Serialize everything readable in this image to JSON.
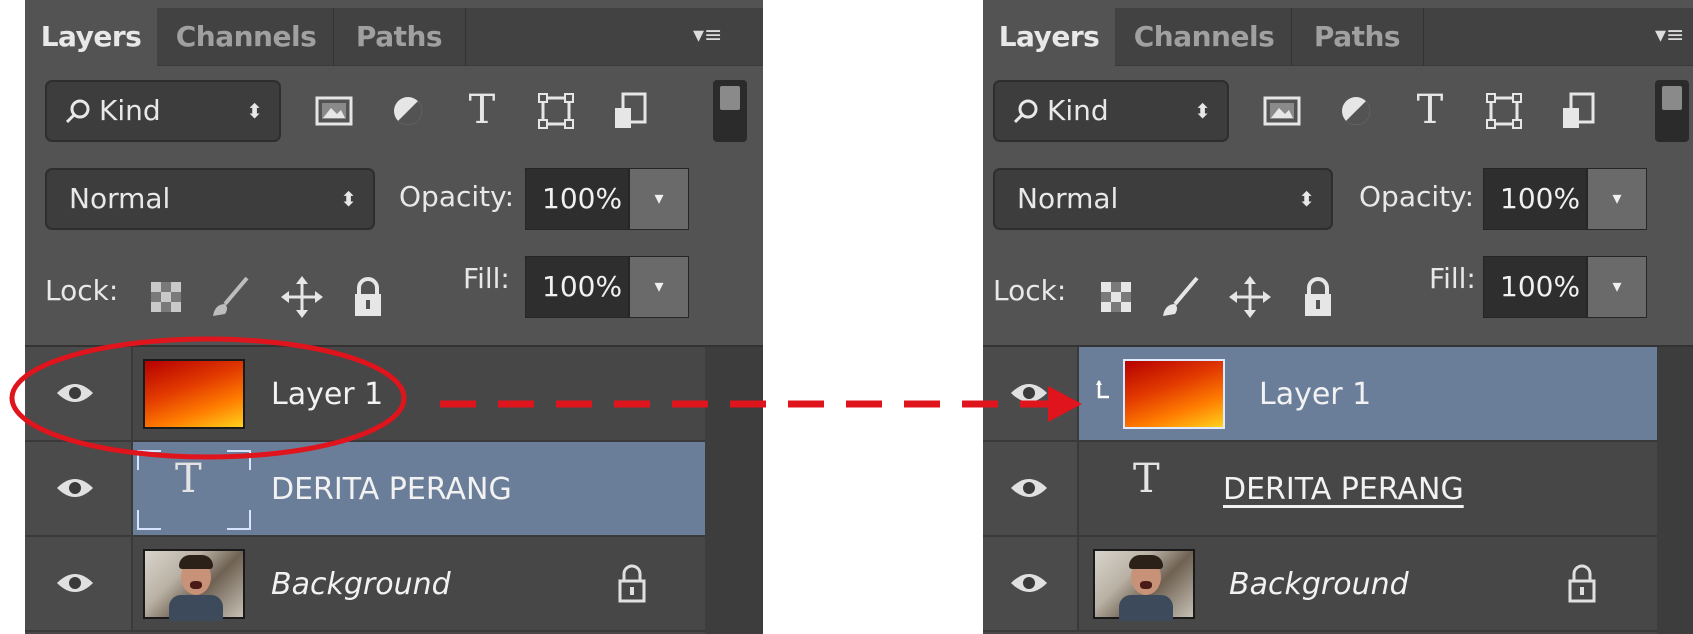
{
  "tabs": [
    "Layers",
    "Channels",
    "Paths"
  ],
  "filter": {
    "kind_label": "Kind"
  },
  "blend": {
    "mode": "Normal",
    "opacity_label": "Opacity:",
    "opacity_value": "100%"
  },
  "lock": {
    "label": "Lock:",
    "fill_label": "Fill:",
    "fill_value": "100%"
  },
  "left_panel": {
    "layers": [
      {
        "name": "Layer 1",
        "thumbnail": "red-orange-gradient"
      },
      {
        "name": "DERITA PERANG",
        "thumbnail": "text-icon",
        "selected": true
      },
      {
        "name": "Background",
        "thumbnail": "photo",
        "locked": true
      }
    ]
  },
  "right_panel": {
    "layers": [
      {
        "name": "Layer 1",
        "thumbnail": "red-orange-gradient",
        "selected": true,
        "clipped": true
      },
      {
        "name": "DERITA PERANG",
        "thumbnail": "text-icon",
        "underlined": true
      },
      {
        "name": "Background",
        "thumbnail": "photo",
        "locked": true
      }
    ]
  },
  "colors": {
    "panel_bg": "#535353",
    "selected_row": "#6b7e99",
    "annotation_red": "#e0141c"
  },
  "icons": [
    "search-icon",
    "image-filter-icon",
    "adjustment-filter-icon",
    "type-filter-icon",
    "shape-filter-icon",
    "smart-object-filter-icon",
    "panel-menu-icon",
    "lock-transparent-icon",
    "lock-paint-icon",
    "lock-move-icon",
    "lock-all-icon",
    "eye-icon",
    "padlock-icon",
    "clip-arrow-icon"
  ]
}
